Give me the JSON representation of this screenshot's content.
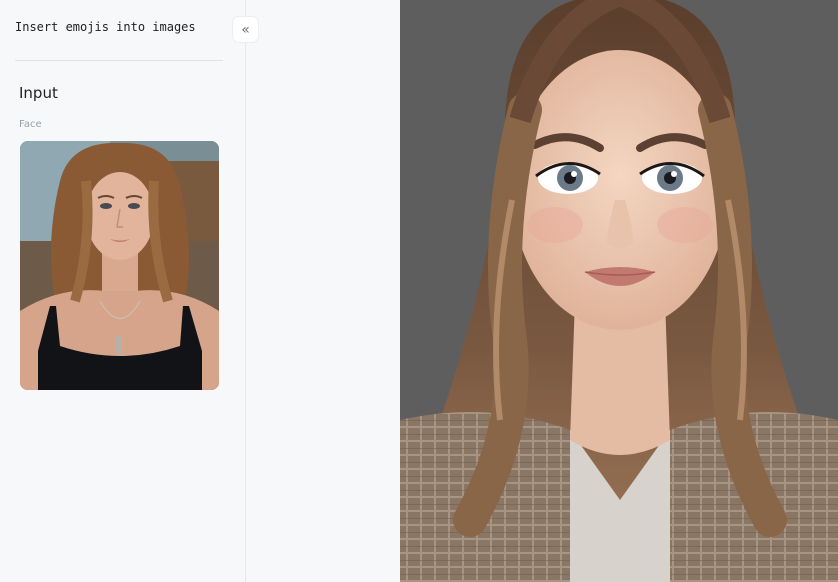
{
  "app": {
    "title": "Insert emojis into images"
  },
  "sidebar": {
    "collapse_icon": "chevrons-left-icon",
    "collapse_glyph": "«",
    "section_title": "Input",
    "face_label": "Face"
  },
  "colors": {
    "sidebar_bg": "#f7f8fa",
    "output_bg": "#5e5e5e",
    "divider": "#dfe2e6"
  }
}
